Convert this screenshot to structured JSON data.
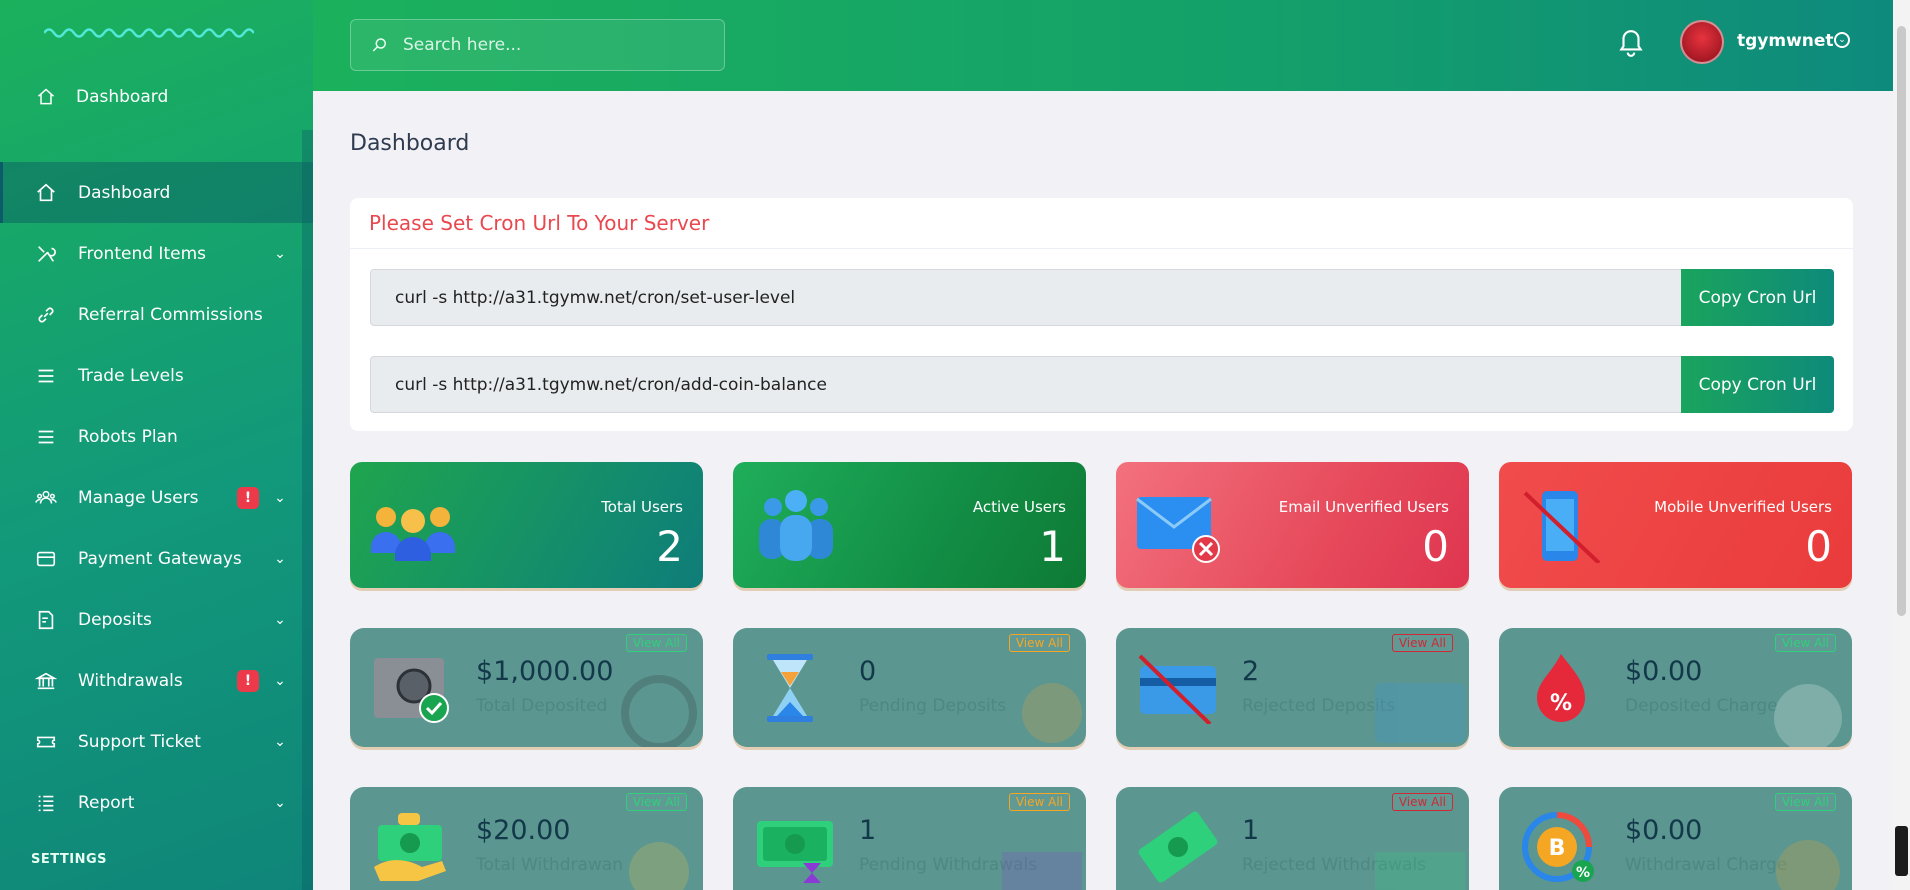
{
  "sidebar": {
    "top_item": "Dashboard",
    "items": [
      {
        "label": "Dashboard",
        "active": true,
        "icon": "home-icon"
      },
      {
        "label": "Frontend Items",
        "chevron": true,
        "icon": "tools-icon"
      },
      {
        "label": "Referral Commissions",
        "icon": "link-icon"
      },
      {
        "label": "Trade Levels",
        "icon": "list-icon"
      },
      {
        "label": "Robots Plan",
        "icon": "list-icon"
      },
      {
        "label": "Manage Users",
        "chevron": true,
        "warn": "!",
        "icon": "users-icon"
      },
      {
        "label": "Payment Gateways",
        "chevron": true,
        "icon": "credit-card-icon"
      },
      {
        "label": "Deposits",
        "chevron": true,
        "icon": "receipt-icon"
      },
      {
        "label": "Withdrawals",
        "chevron": true,
        "warn": "!",
        "icon": "bank-icon"
      },
      {
        "label": "Support Ticket",
        "chevron": true,
        "icon": "ticket-icon"
      },
      {
        "label": "Report",
        "chevron": true,
        "icon": "report-list-icon"
      }
    ],
    "settings_label": "SETTINGS"
  },
  "topbar": {
    "search_placeholder": "Search here...",
    "username": "tgymwnet"
  },
  "main": {
    "page_title": "Dashboard",
    "cron": {
      "title": "Please Set Cron Url To Your Server",
      "rows": [
        {
          "url": "curl -s http://a31.tgymw.net/cron/set-user-level",
          "button": "Copy Cron Url"
        },
        {
          "url": "curl -s http://a31.tgymw.net/cron/add-coin-balance",
          "button": "Copy Cron Url"
        }
      ]
    },
    "stats": [
      {
        "label": "Total Users",
        "value": "2"
      },
      {
        "label": "Active Users",
        "value": "1"
      },
      {
        "label": "Email Unverified Users",
        "value": "0"
      },
      {
        "label": "Mobile Unverified Users",
        "value": "0"
      }
    ],
    "deposit_cards": [
      {
        "amount": "$1,000.00",
        "label": "Total Deposited",
        "view": "View All"
      },
      {
        "amount": "0",
        "label": "Pending Deposits",
        "view": "View All"
      },
      {
        "amount": "2",
        "label": "Rejected Deposits",
        "view": "View All"
      },
      {
        "amount": "$0.00",
        "label": "Deposited Charge",
        "view": "View All"
      }
    ],
    "withdraw_cards": [
      {
        "amount": "$20.00",
        "label": "Total Withdrawan",
        "view": "View All"
      },
      {
        "amount": "1",
        "label": "Pending Withdrawals",
        "view": "View All"
      },
      {
        "amount": "1",
        "label": "Rejected Withdrawals",
        "view": "View All"
      },
      {
        "amount": "$0.00",
        "label": "Withdrawal Charge",
        "view": "View All"
      }
    ]
  },
  "colors": {
    "brand_green": "#1bb15c",
    "brand_teal": "#0e8a7d",
    "danger": "#e8484e",
    "card_teal": "#5b9690"
  }
}
